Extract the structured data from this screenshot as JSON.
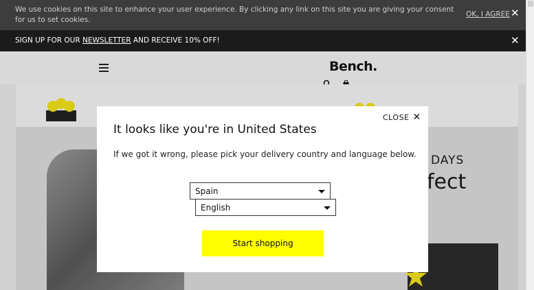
{
  "cookie_bar": {
    "text": "We use cookies on this site to enhance your user experience. By clicking any link on this site you are giving your consent for us to set cookies.",
    "agree_label": "OK, I AGREE",
    "close_label": "✕"
  },
  "newsletter_bar": {
    "text_before": "SIGN UP FOR OUR ",
    "link_label": "NEWSLETTER",
    "text_after": " AND RECEIVE 10% OFF!",
    "close_label": "✕"
  },
  "header": {
    "logo": "Bench."
  },
  "hero": {
    "text1": "DAYS",
    "text2": "fect"
  },
  "modal": {
    "close_label": "CLOSE",
    "close_icon": "✕",
    "title": "It looks like you're in United States",
    "description": "If we got it wrong, please pick your delivery country and language below.",
    "country_value": "Spain",
    "language_value": "English",
    "button_label": "Start shopping"
  },
  "colors": {
    "accent": "#ffff00",
    "cookie_bg": "#3d3d3d",
    "newsletter_bg": "#1b1b1b"
  },
  "icons": {
    "menu": "hamburger-icon",
    "search": "search-icon",
    "bag": "bag-icon"
  }
}
